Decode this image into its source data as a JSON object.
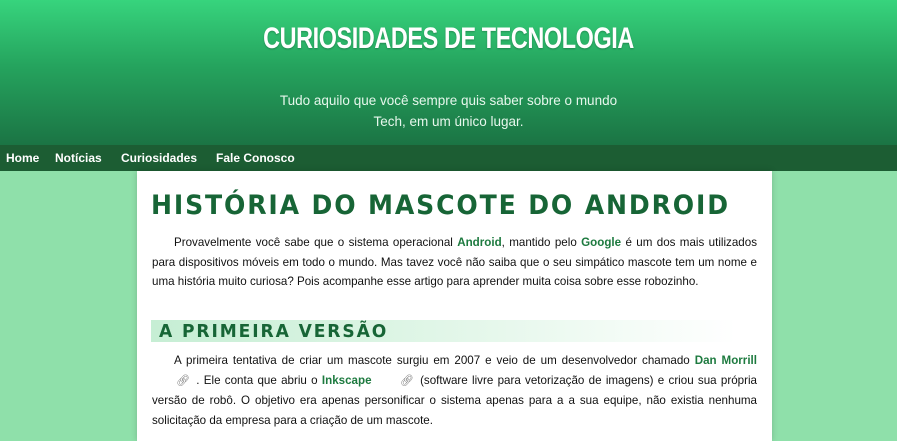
{
  "header": {
    "title": "CURIOSIDADES DE TECNOLOGIA",
    "subtitle_line1": "Tudo aquilo que você sempre quis saber sobre o mundo",
    "subtitle_line2": "Tech, em um único lugar."
  },
  "nav": {
    "items": [
      {
        "label": "Home"
      },
      {
        "label": "Notícias"
      },
      {
        "label": "Curiosidades"
      },
      {
        "label": "Fale Conosco"
      }
    ]
  },
  "article": {
    "title": "HISTÓRIA DO MASCOTE DO ANDROID",
    "intro": {
      "t1": "Provavelmente você sabe que o sistema operacional ",
      "android": "Android",
      "t2": ", mantido pelo ",
      "google": "Google",
      "t3": " é um dos mais utilizados para dispositivos móveis em todo o mundo. Mas tavez você não saiba que o seu simpático mascote tem um nome e uma história muito curiosa? Pois acompanhe esse artigo para aprender muita coisa sobre esse robozinho."
    },
    "section1": {
      "heading": "A PRIMEIRA VERSÃO",
      "t1": "A primeira tentativa de criar um mascote surgiu em 2007 e veio de um desenvolvedor chamado ",
      "dan": "Dan Morrill",
      "t2": " . Ele conta que abriu o ",
      "inkscape": "Inkscape",
      "t3": " (software livre para vetorização de imagens) e criou sua própria versão de robô. O objetivo era apenas personificar o sistema apenas para a a sua equipe, não existia nenhuma solicitação da empresa para a criação de um mascote."
    }
  },
  "icons": {
    "external_link": "link-icon"
  },
  "colors": {
    "header_top": "#37d47d",
    "header_bottom": "#1b7444",
    "nav_bg": "#1c5d33",
    "page_bg": "#8fe0aa",
    "accent_text": "#176536"
  }
}
